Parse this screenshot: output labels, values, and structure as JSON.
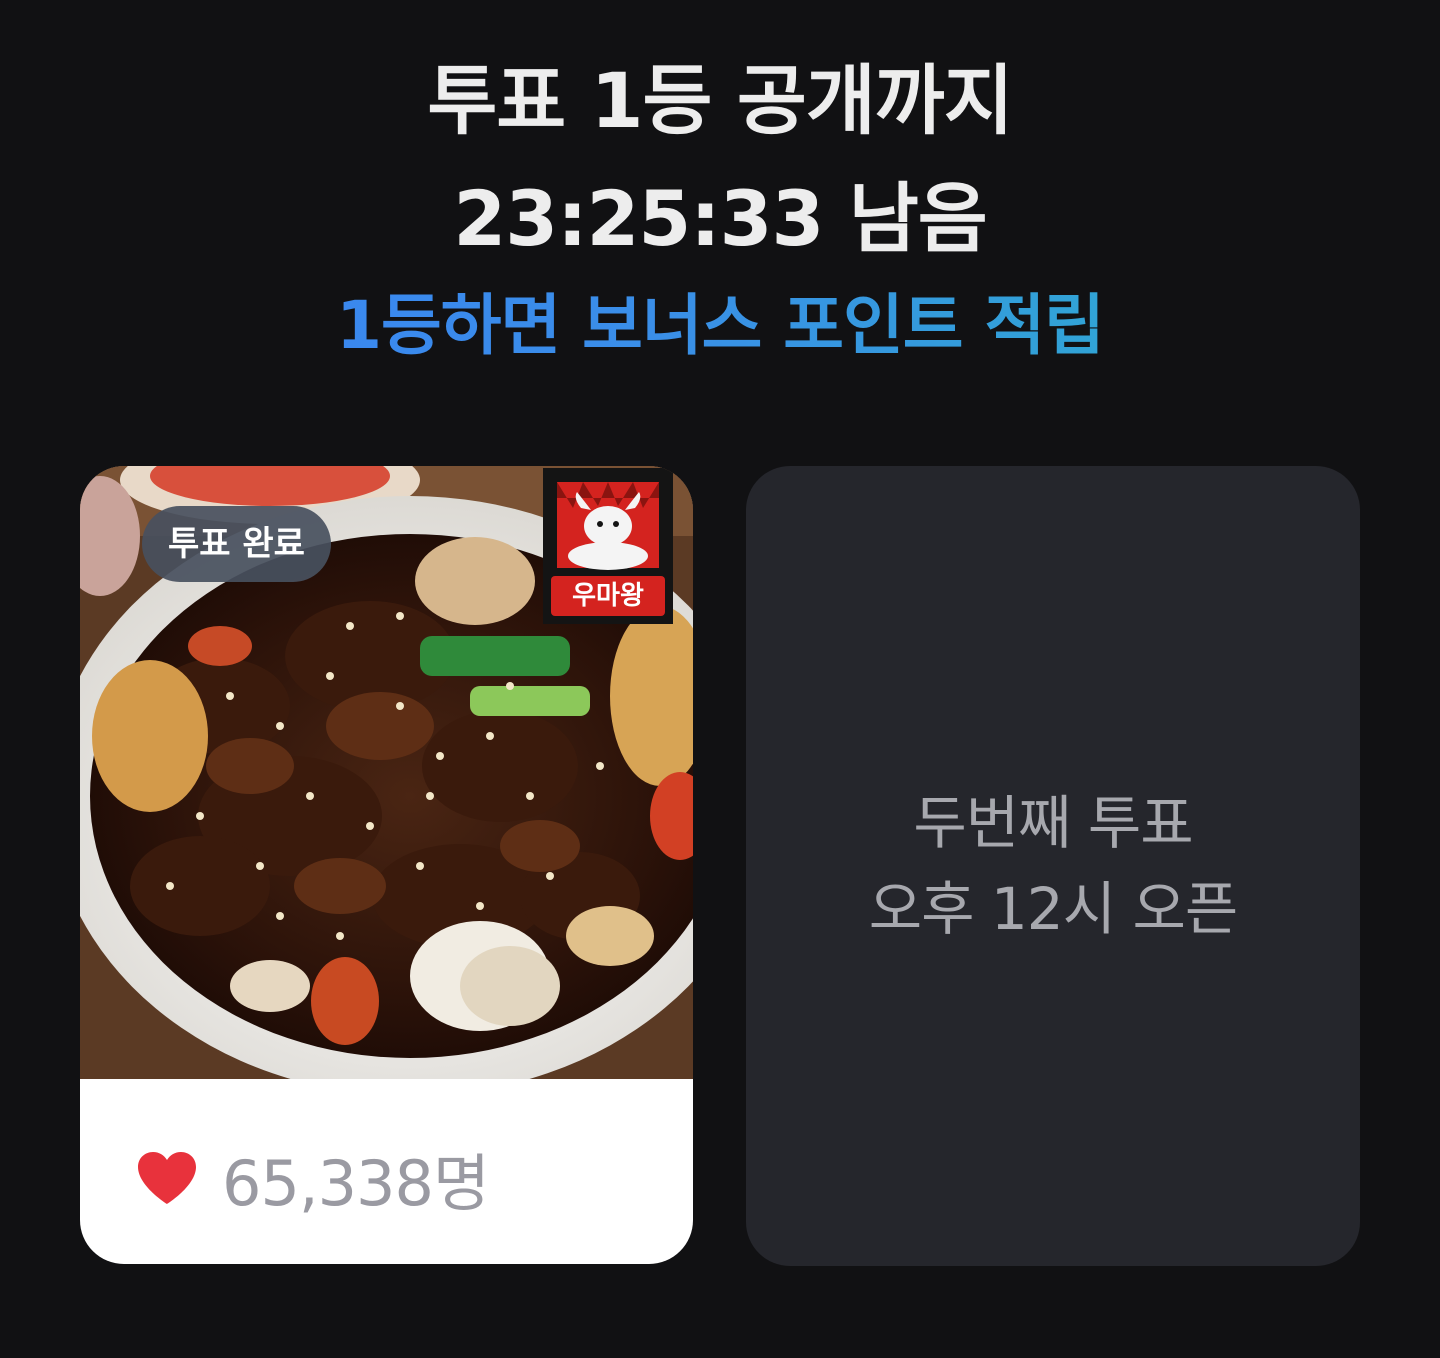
{
  "header": {
    "title_line1": "투표 1등 공개까지",
    "title_line2": "23:25:33 남음",
    "subtitle": "1등하면 보너스 포인트 적립"
  },
  "vote_card": {
    "badge": "투표 완료",
    "brand_logo_text": "우마왕",
    "like_icon": "heart-icon",
    "like_count": "65,338명"
  },
  "locked_card": {
    "line1": "두번째 투표",
    "line2": "오후 12시 오픈"
  },
  "colors": {
    "background": "#111113",
    "subtitle_gradient_start": "#3b82f6",
    "subtitle_gradient_end": "#2ab3c8",
    "heart": "#e8323c",
    "locked_card": "#25262c"
  }
}
